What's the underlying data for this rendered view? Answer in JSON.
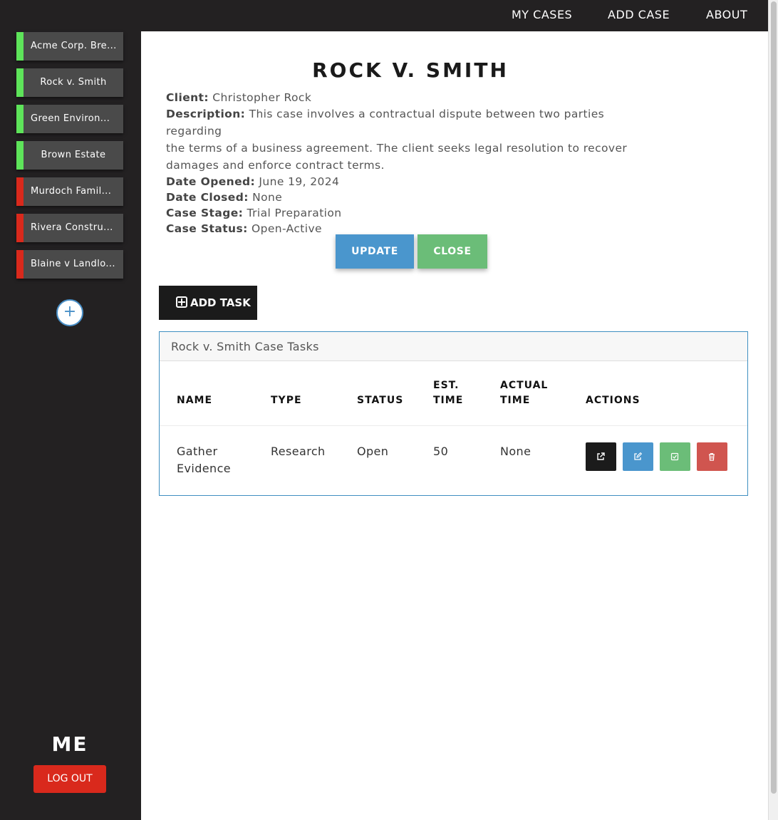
{
  "nav": {
    "my_cases": "MY CASES",
    "add_case": "ADD CASE",
    "about": "ABOUT"
  },
  "sidebar": {
    "cases": [
      {
        "label": "Acme Corp. Bre...",
        "status_color": "#5ee45a"
      },
      {
        "label": "Rock v. Smith",
        "status_color": "#5ee45a"
      },
      {
        "label": "Green Environ...",
        "status_color": "#5ee45a"
      },
      {
        "label": "Brown Estate",
        "status_color": "#5ee45a"
      },
      {
        "label": "Murdoch Famil...",
        "status_color": "#d9291c"
      },
      {
        "label": "Rivera Constru...",
        "status_color": "#d9291c"
      },
      {
        "label": "Blaine v Landlo...",
        "status_color": "#d9291c"
      }
    ],
    "add_icon": "+",
    "user_name": "ME",
    "logout_label": "LOG OUT"
  },
  "case": {
    "title": "ROCK V. SMITH",
    "client_label": "Client:",
    "client": "Christopher Rock",
    "description_label": "Description:",
    "description_line1": "This case involves a contractual dispute between two parties regarding",
    "description_line2": "the terms of a business agreement. The client seeks legal resolution to recover",
    "description_line3": "damages and enforce contract terms.",
    "date_opened_label": "Date Opened:",
    "date_opened": "June 19, 2024",
    "date_closed_label": "Date Closed:",
    "date_closed": "None",
    "stage_label": "Case Stage:",
    "stage": "Trial Preparation",
    "status_label": "Case Status:",
    "status": "Open-Active",
    "update_label": "UPDATE",
    "close_label": "CLOSE"
  },
  "tasks": {
    "add_label": "ADD TASK",
    "panel_title": "Rock v. Smith Case Tasks",
    "headers": {
      "name": "NAME",
      "type": "TYPE",
      "status": "STATUS",
      "est_1": "EST.",
      "est_2": "TIME",
      "actual_1": "ACTUAL",
      "actual_2": "TIME",
      "actions": "ACTIONS"
    },
    "rows": [
      {
        "name_1": "Gather",
        "name_2": "Evidence",
        "type": "Research",
        "status": "Open",
        "est_time": "50",
        "actual_time": "None"
      }
    ],
    "action_colors": {
      "open": "#1b1b1b",
      "edit": "#4a96cd",
      "complete": "#6bbd78",
      "delete": "#d0554f"
    }
  }
}
